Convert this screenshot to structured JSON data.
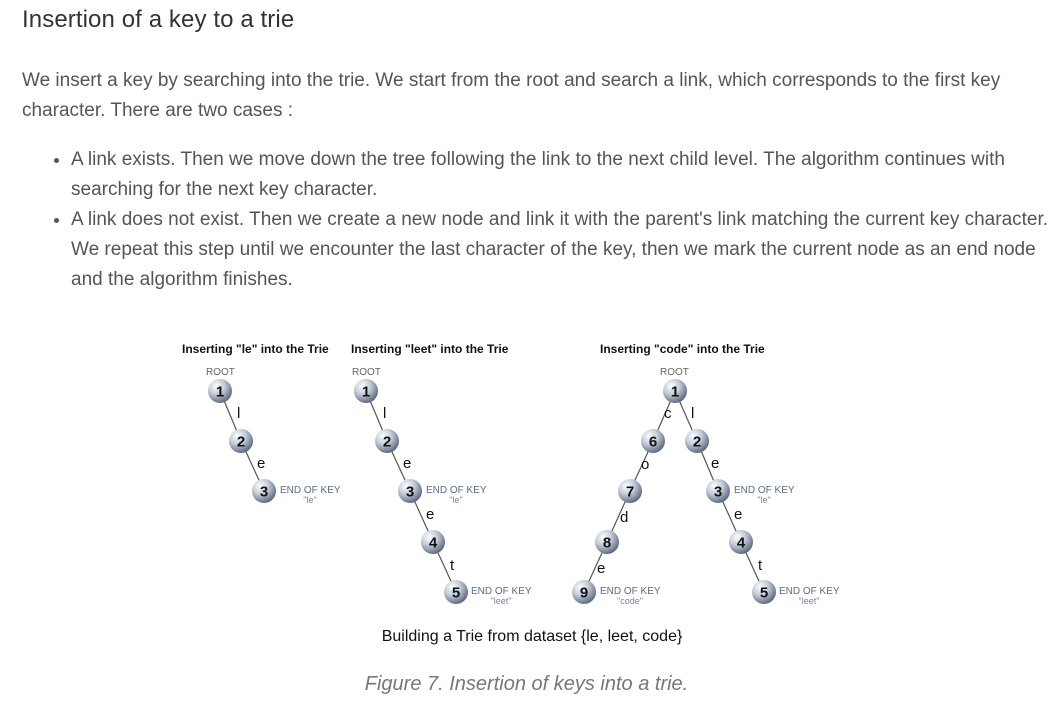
{
  "heading": "Insertion of a key to a trie",
  "intro": "We insert a key by searching into the trie. We start from the root and search a link, which corresponds to the first key character. There are two cases :",
  "cases": [
    "A link exists. Then we move down the tree following the link to the next child level. The algorithm continues with searching for the next key character.",
    "A link does not exist. Then we create a new node and link it with the parent's link matching the current key character. We repeat this step until we encounter the last character of the key, then we mark the current node as an end node and the algorithm finishes."
  ],
  "figure": {
    "main_label": "Building a Trie from dataset {le, leet, code}",
    "caption": "Figure 7. Insertion of keys into a trie.",
    "node_color": "#9aa6b8",
    "panels": [
      {
        "title": "Inserting \"le\" into the Trie",
        "root_label": "ROOT",
        "nodes": [
          "1",
          "2",
          "3"
        ],
        "edges": [
          "l",
          "e"
        ],
        "end_markers": [
          {
            "label": "END OF KEY",
            "sub": "\"le\""
          }
        ]
      },
      {
        "title": "Inserting \"leet\" into the Trie",
        "root_label": "ROOT",
        "nodes": [
          "1",
          "2",
          "3",
          "4",
          "5"
        ],
        "edges": [
          "l",
          "e",
          "e",
          "t"
        ],
        "end_markers": [
          {
            "label": "END OF KEY",
            "sub": "\"le\""
          },
          {
            "label": "END OF KEY",
            "sub": "\"leet\""
          }
        ]
      },
      {
        "title": "Inserting \"code\" into the Trie",
        "root_label": "ROOT",
        "nodes": [
          "1",
          "6",
          "7",
          "8",
          "9",
          "2",
          "3",
          "4",
          "5"
        ],
        "edges": [
          "c",
          "o",
          "d",
          "e",
          "l",
          "e",
          "e",
          "t"
        ],
        "end_markers": [
          {
            "label": "END OF KEY",
            "sub": "\"code\""
          },
          {
            "label": "END OF KEY",
            "sub": "\"le\""
          },
          {
            "label": "END OF KEY",
            "sub": "\"leet\""
          }
        ]
      }
    ]
  }
}
